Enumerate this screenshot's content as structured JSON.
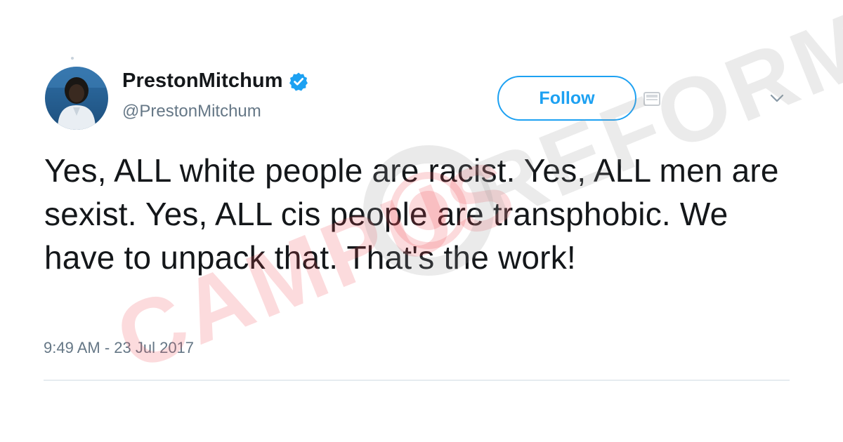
{
  "tweet": {
    "display_name": "PrestonMitchum",
    "verified": true,
    "handle": "@PrestonMitchum",
    "follow_label": "Follow",
    "text": "Yes, ALL white people are racist. Yes, ALL men are sexist. Yes, ALL cis people are transphobic. We have to unpack that. That's the work!",
    "timestamp": "9:49 AM - 23 Jul 2017"
  },
  "watermark": {
    "left_word": "CAMPUS",
    "right_word": "REFORM"
  },
  "colors": {
    "accent": "#1da1f2",
    "text": "#14171a",
    "secondary_text": "#657786",
    "divider": "#e6ecf0",
    "watermark_red": "#f24d57",
    "watermark_gray": "#9a9a9a"
  },
  "icons": {
    "verified": "verified-badge-icon",
    "follow_extra": "follow-icon",
    "more": "chevron-down-icon"
  }
}
